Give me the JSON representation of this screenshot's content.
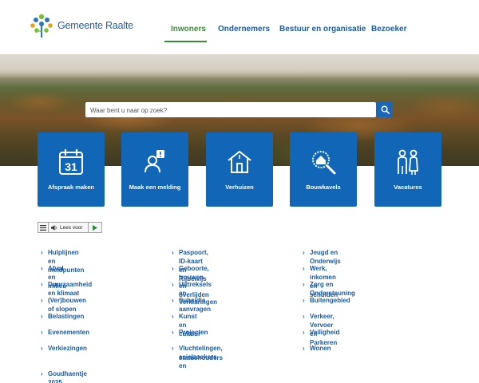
{
  "header": {
    "logo_text": "Gemeente Raalte",
    "nav": [
      {
        "label": "Inwoners",
        "active": true
      },
      {
        "label": "Ondernemers",
        "active": false
      },
      {
        "label": "Bestuur en organisatie",
        "active": false
      },
      {
        "label": "Bezoeker",
        "active": false
      }
    ]
  },
  "search": {
    "placeholder": "Waar bent u naar op zoek?"
  },
  "tiles": [
    {
      "label": "Afspraak maken",
      "icon": "calendar-icon",
      "day": "31"
    },
    {
      "label": "Maak een melding",
      "icon": "report-person-icon"
    },
    {
      "label": "Verhuizen",
      "icon": "house-icon"
    },
    {
      "label": "Bouwkavels",
      "icon": "magnifier-house-icon"
    },
    {
      "label": "Vacatures",
      "icon": "people-icon"
    }
  ],
  "readaloud": {
    "label": "Lees voor"
  },
  "links": {
    "col1": [
      "Hulplijnen en meldpunten",
      "Afval en milieu",
      "Duurzaamheid en klimaat",
      "(Ver)bouwen of slopen",
      "Belastingen",
      "Evenementen",
      "Verkiezingen",
      "Goudhaentje 2025"
    ],
    "col2": [
      "Paspoort, ID-kaart en Rijbewijs",
      "Geboorte, trouwen en overlijden",
      "Uittreksels en Verklaringen",
      "Subsidie aanvragen",
      "Kunst en cultuur",
      "Projecten",
      "Vluchtelingen, asielzoekers en",
      "statushouders"
    ],
    "col3": [
      "Jeugd en Onderwijs",
      "Werk, inkomen en schulden",
      "Zorg en Ondersteuning",
      "Buitengebied",
      "Verkeer, Vervoer en Parkeren",
      "Veiligheid",
      "Wonen"
    ]
  },
  "colors": {
    "brand_blue": "#1266b8",
    "link_blue": "#1a5aa6",
    "active_green": "#3b8a3a"
  }
}
